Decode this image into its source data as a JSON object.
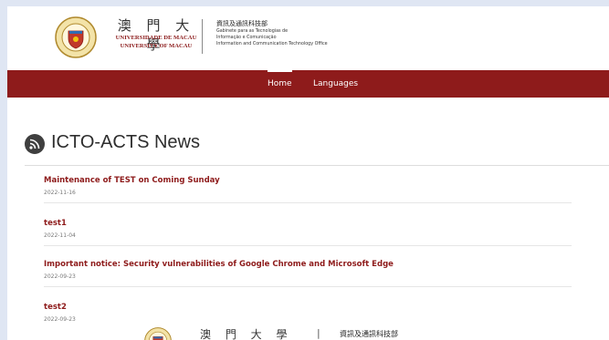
{
  "header": {
    "logo_icon": "university-of-macau-crest-icon",
    "um_name_zh": "澳 門 大 學",
    "um_name_pt": "UNIVERSIDADE DE MACAU",
    "um_name_en": "UNIVERSITY OF MACAU",
    "office_name_zh": "資訊及通訊科技部",
    "office_lines": [
      "Gabinete para as Tecnologias de",
      "Informação e Comunicação",
      "Information and Communication Technology Office"
    ]
  },
  "nav": {
    "items": [
      {
        "label": "Home",
        "active": true
      },
      {
        "label": "Languages",
        "active": false
      }
    ],
    "background": "#8e1b1b"
  },
  "news": {
    "icon": "rss-icon",
    "title": "ICTO-ACTS News",
    "items": [
      {
        "title": "Maintenance of TEST on Coming Sunday",
        "date": "2022-11-16"
      },
      {
        "title": "test1",
        "date": "2022-11-04"
      },
      {
        "title": "Important notice: Security vulnerabilities of Google Chrome and Microsoft Edge",
        "date": "2022-09-23"
      },
      {
        "title": "test2",
        "date": "2022-09-23"
      }
    ]
  },
  "footer": {
    "logo_icon": "university-of-macau-crest-icon",
    "um_name_zh": "澳 門 大 學",
    "separator": "|",
    "office_name_zh": "資訊及通訊科技部"
  },
  "colors": {
    "accent": "#8e1b1b",
    "page_background": "#dfe6f3"
  }
}
